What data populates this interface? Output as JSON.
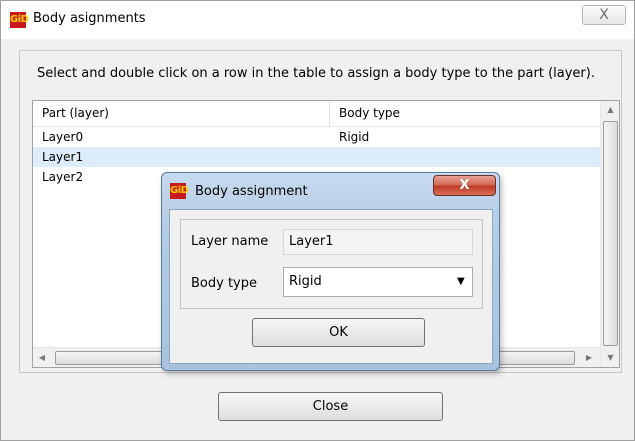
{
  "window": {
    "title": "Body asignments",
    "logo_text": "GiD",
    "close_icon": "X"
  },
  "instructions": "Select and double click on a row in the table to assign a body type to the part (layer).",
  "table": {
    "columns": [
      "Part (layer)",
      "Body type"
    ],
    "rows": [
      {
        "part": "Layer0",
        "body_type": "Rigid",
        "selected": false
      },
      {
        "part": "Layer1",
        "body_type": "",
        "selected": true
      },
      {
        "part": "Layer2",
        "body_type": "",
        "selected": false
      }
    ]
  },
  "footer": {
    "close_label": "Close"
  },
  "dialog": {
    "title": "Body assignment",
    "logo_text": "GiD",
    "close_icon": "X",
    "layer_name_label": "Layer name",
    "layer_name_value": "Layer1",
    "body_type_label": "Body type",
    "body_type_value": "Rigid",
    "ok_label": "OK"
  },
  "colors": {
    "selection": "#dcecf8",
    "dialog_frame": "#b3cbe4",
    "close_red": "#c03a25",
    "logo_red": "#c8191e"
  }
}
